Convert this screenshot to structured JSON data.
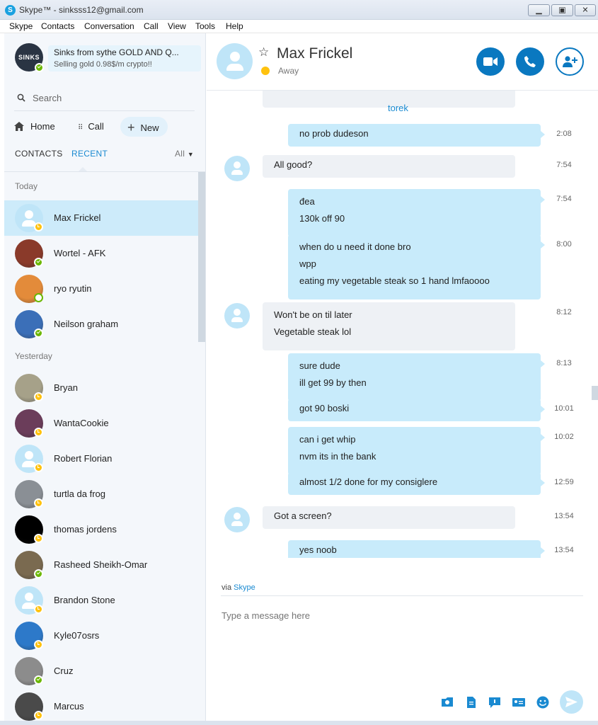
{
  "window": {
    "title": "Skype™ - sinksss12@gmail.com",
    "app_icon_letter": "S"
  },
  "menu": [
    "Skype",
    "Contacts",
    "Conversation",
    "Call",
    "View",
    "Tools",
    "Help"
  ],
  "profile": {
    "avatar_text": "SINKS",
    "name": "Sinks from sythe GOLD AND Q...",
    "mood": "Selling gold 0.98$/m crypto!!",
    "status": "online"
  },
  "search": {
    "placeholder": "Search"
  },
  "nav": {
    "home": "Home",
    "call": "Call",
    "new": "New"
  },
  "tabs": {
    "contacts": "CONTACTS",
    "recent": "RECENT",
    "filter": "All"
  },
  "sections": {
    "today": "Today",
    "yesterday": "Yesterday"
  },
  "contacts_today": [
    {
      "name": "Max Frickel",
      "status": "away",
      "avatar": "default",
      "color": "#bfe5f8",
      "active": true
    },
    {
      "name": "Wortel - AFK",
      "status": "online",
      "avatar": "photo",
      "color": "#8a3a2a"
    },
    {
      "name": "ryo ryutin",
      "status": "offline",
      "avatar": "photo",
      "color": "#e38b3a"
    },
    {
      "name": "Neilson graham",
      "status": "online",
      "avatar": "photo",
      "color": "#3b6fb8"
    }
  ],
  "contacts_yesterday": [
    {
      "name": "Bryan",
      "status": "away",
      "avatar": "photo",
      "color": "#a6a189"
    },
    {
      "name": "WantaCookie",
      "status": "away",
      "avatar": "photo",
      "color": "#6b3d5a"
    },
    {
      "name": "Robert Florian",
      "status": "away",
      "avatar": "default",
      "color": "#bfe5f8"
    },
    {
      "name": "turtla da frog",
      "status": "away",
      "avatar": "photo",
      "color": "#8a8f95"
    },
    {
      "name": "thomas jordens",
      "status": "away",
      "avatar": "photo",
      "color": "#000000"
    },
    {
      "name": "Rasheed Sheikh-Omar",
      "status": "online",
      "avatar": "photo",
      "color": "#7a6a50"
    },
    {
      "name": "Brandon Stone",
      "status": "away",
      "avatar": "default",
      "color": "#bfe5f8"
    },
    {
      "name": "Kyle07osrs",
      "status": "away",
      "avatar": "photo",
      "color": "#2d79c9"
    },
    {
      "name": "Cruz",
      "status": "online",
      "avatar": "photo",
      "color": "#8c8c8c"
    },
    {
      "name": "Marcus",
      "status": "away",
      "avatar": "photo",
      "color": "#4a4a4a"
    }
  ],
  "chat": {
    "contact_name": "Max Frickel",
    "contact_status": "Away",
    "divider_name": "torek",
    "messages": [
      {
        "dir": "out",
        "lines": [
          "no prob dudeson"
        ],
        "time": "2:08"
      },
      {
        "dir": "in",
        "lines": [
          "All good?"
        ],
        "time": "7:54"
      },
      {
        "dir": "out",
        "lines": [
          "đea",
          "130k off 90"
        ],
        "time": "7:54"
      },
      {
        "dir": "out",
        "lines": [
          "when do u need it done bro",
          "wpp",
          "eating my vegetable steak so 1 hand lmfaoooo"
        ],
        "time": "8:00"
      },
      {
        "dir": "in",
        "lines": [
          "Won't be on til later",
          "Vegetable steak lol"
        ],
        "time": "8:12"
      },
      {
        "dir": "out",
        "lines": [
          "sure dude",
          "ill get 99 by then"
        ],
        "time": "8:13"
      },
      {
        "dir": "out",
        "lines": [
          "got 90 boski"
        ],
        "time": "10:01"
      },
      {
        "dir": "out",
        "lines": [
          "can i get whip",
          "nvm its in the bank"
        ],
        "time": "10:02"
      },
      {
        "dir": "out",
        "lines": [
          "almost 1/2 done for my consiglere"
        ],
        "time": "12:59"
      },
      {
        "dir": "in",
        "lines": [
          "Got a screen?"
        ],
        "time": "13:54"
      },
      {
        "dir": "out",
        "lines": [
          "yes noob"
        ],
        "time": "13:54"
      }
    ]
  },
  "compose": {
    "via_prefix": "via",
    "via_link": "Skype",
    "placeholder": "Type a message here"
  },
  "colors": {
    "accent": "#0a78c0",
    "link": "#1a8ad1",
    "bubble_out": "#c8ebfb",
    "bubble_in": "#eef1f5",
    "online": "#6bb700",
    "away": "#ffc20e"
  }
}
